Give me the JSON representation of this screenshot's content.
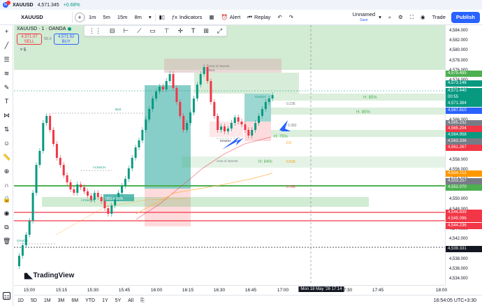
{
  "browser": {
    "favicon_badge": "M",
    "symbol": "XAUUSD",
    "price": "4,571.345",
    "change": "+0.68%"
  },
  "topbar": {
    "symbol": "XAUUSD",
    "add": "+",
    "intervals": [
      "1m",
      "5m",
      "15m",
      "8m"
    ],
    "indicators": "Indicators",
    "alert": "Alert",
    "replay": "Replay",
    "layout_name": "Unnamed",
    "layout_status": "Save",
    "trade": "Trade",
    "publish": "Publish"
  },
  "legend": {
    "title": "XAUUSD · 1 · OANDA",
    "sell_price": "4,571.07",
    "sell_super": "0",
    "sell_label": "SELL",
    "spread": "55.0",
    "buy_price": "4,571.62",
    "buy_super": "0",
    "buy_label": "BUY",
    "collapse": "5"
  },
  "chart_labels": {
    "area_of_interest": "Area of interest",
    "area_of_interest_2": "Area of interest",
    "bos": "BoS",
    "choch": "CHoCH",
    "i_choch": "i-CHoCH",
    "obs_pct": "OBS A 85%",
    "h85_a": "H: 85%",
    "h85_b": "H: 85%",
    "h75": "H: 75%",
    "h84": "H: 84%",
    "fib_236": "0.236",
    "fib_382": "0.382",
    "fib_5": "0.5",
    "fib_618": "0.618",
    "fib_786": "0.786",
    "bos2": "1-BoS",
    "choch_left": "CHoCH",
    "ichoch2": "i-CHoCH"
  },
  "price_scale": {
    "ticks": [
      "4,584.000",
      "4,582.000",
      "4,580.000",
      "4,578.000",
      "4,576.000",
      "4,574.000",
      "4,572.000",
      "4,570.000",
      "4,568.000",
      "4,566.000",
      "4,564.000",
      "4,562.000",
      "4,560.000",
      "4,558.000",
      "4,556.000",
      "4,554.000",
      "4,552.000",
      "4,550.000",
      "4,548.000",
      "4,546.000",
      "4,544.000",
      "4,542.000",
      "4,540.000",
      "4,538.000",
      "4,536.000",
      "4,534.000"
    ],
    "labels": [
      {
        "text": "4,575.485",
        "color": "#4caf50"
      },
      {
        "text": "4,573.148",
        "color": "#089981"
      },
      {
        "text": "4,571.440",
        "color": "#089981"
      },
      {
        "text": "00:55",
        "color": "#089981"
      },
      {
        "text": "4,571.384",
        "color": "#089981"
      },
      {
        "text": "4,567.810",
        "color": "#2962ff"
      },
      {
        "text": "4,565.232",
        "color": "#787b86"
      },
      {
        "text": "4,565.204",
        "color": "#f23645"
      },
      {
        "text": "4,564.958",
        "color": "#089981"
      },
      {
        "text": "4,563.336",
        "color": "#787b86"
      },
      {
        "text": "4,561.267",
        "color": "#f23645"
      },
      {
        "text": "4,554.712",
        "color": "#ff9800"
      },
      {
        "text": "4,553.257",
        "color": "#787b86"
      },
      {
        "text": "4,552.070",
        "color": "#4caf50"
      },
      {
        "text": "4,546.839",
        "color": "#f23645"
      },
      {
        "text": "4,545.096",
        "color": "#f23645"
      },
      {
        "text": "4,544.236",
        "color": "#f23645"
      },
      {
        "text": "4,539.331",
        "color": "#131722"
      }
    ]
  },
  "time_scale": {
    "ticks": [
      "15:00",
      "15:15",
      "15:30",
      "15:45",
      "16:00",
      "16:15",
      "16:30",
      "16:45",
      "17:00",
      "17:30",
      "17:45",
      "18:00"
    ],
    "crosshair": "Mon 18 May '26  17:14"
  },
  "bottom_bar": {
    "ranges": [
      "1D",
      "5D",
      "1M",
      "3M",
      "6M",
      "YTD",
      "1Y",
      "5Y",
      "All"
    ],
    "clock": "16:54:05 UTC+3:30"
  },
  "brand": {
    "logo_text": "TradingView"
  },
  "colors": {
    "up": "#089981",
    "down": "#f23645",
    "accent": "#2962ff",
    "zone_green": "#4caf50"
  }
}
